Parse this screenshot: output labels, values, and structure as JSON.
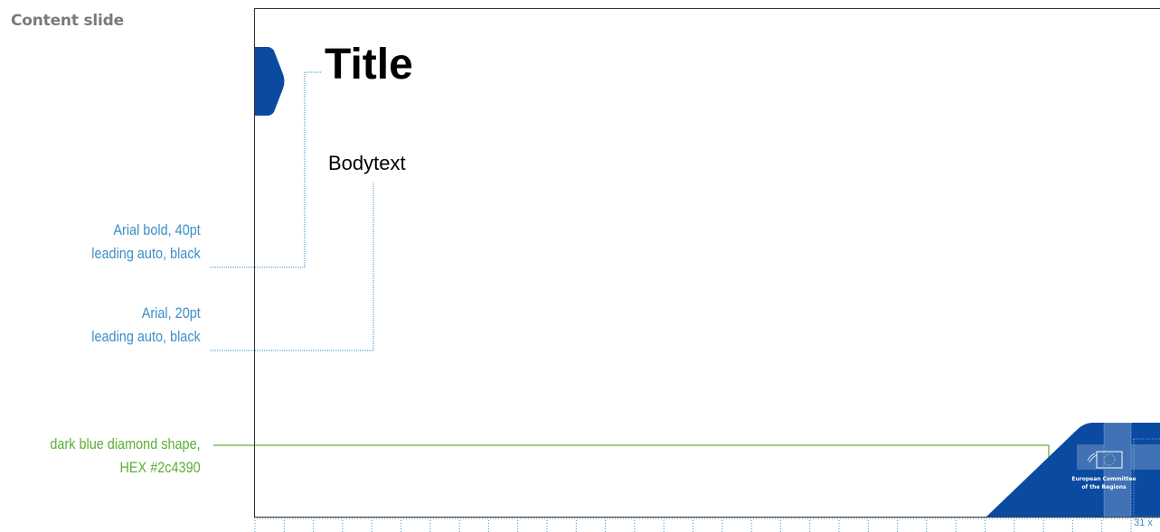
{
  "section_label": "Content slide",
  "slide": {
    "title": "Title",
    "body": "Bodytext",
    "logo": {
      "line1": "European Committee",
      "line2": "of the Regions"
    }
  },
  "annotations": {
    "title_spec": {
      "line1": "Arial bold, 40pt",
      "line2": "leading auto, black"
    },
    "body_spec": {
      "line1": "Arial, 20pt",
      "line2": "leading auto, black"
    },
    "shape_spec": {
      "line1": "dark blue diamond shape,",
      "line2": "HEX #2c4390"
    }
  },
  "grid_badge": "31 x",
  "colors": {
    "diamond": "#0a4aa1",
    "annotation_blue": "#3d8fc7",
    "annotation_green": "#5cae35"
  }
}
